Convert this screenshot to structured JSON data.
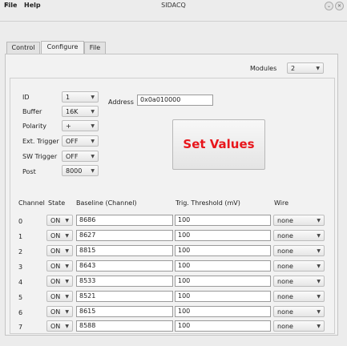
{
  "window": {
    "title": "SIDACQ"
  },
  "menubar": {
    "file": "File",
    "help": "Help"
  },
  "tabs": [
    "Control",
    "Configure",
    "File"
  ],
  "modules": {
    "label": "Modules",
    "value": "2"
  },
  "config": {
    "fields": [
      {
        "label": "ID",
        "value": "1"
      },
      {
        "label": "Buffer",
        "value": "16K"
      },
      {
        "label": "Polarity",
        "value": "+"
      },
      {
        "label": "Ext. Trigger",
        "value": "OFF"
      },
      {
        "label": "SW Trigger",
        "value": "OFF"
      },
      {
        "label": "Post",
        "value": "8000"
      }
    ],
    "address_label": "Address",
    "address_value": "0x0a010000",
    "set_values": "Set Values"
  },
  "table": {
    "headers": {
      "channel": "Channel",
      "state": "State",
      "baseline": "Baseline (Channel)",
      "threshold": "Trig. Threshold (mV)",
      "wire": "Wire"
    },
    "rows": [
      {
        "ch": "0",
        "state": "ON",
        "baseline": "8686",
        "threshold": "100",
        "wire": "none"
      },
      {
        "ch": "1",
        "state": "ON",
        "baseline": "8627",
        "threshold": "100",
        "wire": "none"
      },
      {
        "ch": "2",
        "state": "ON",
        "baseline": "8815",
        "threshold": "100",
        "wire": "none"
      },
      {
        "ch": "3",
        "state": "ON",
        "baseline": "8643",
        "threshold": "100",
        "wire": "none"
      },
      {
        "ch": "4",
        "state": "ON",
        "baseline": "8533",
        "threshold": "100",
        "wire": "none"
      },
      {
        "ch": "5",
        "state": "ON",
        "baseline": "8521",
        "threshold": "100",
        "wire": "none"
      },
      {
        "ch": "6",
        "state": "ON",
        "baseline": "8615",
        "threshold": "100",
        "wire": "none"
      },
      {
        "ch": "7",
        "state": "ON",
        "baseline": "8588",
        "threshold": "100",
        "wire": "none"
      }
    ]
  },
  "colors": {
    "accent": "#e8151b",
    "window_bg": "#ececec",
    "panel_bg": "#f2f2f2"
  }
}
